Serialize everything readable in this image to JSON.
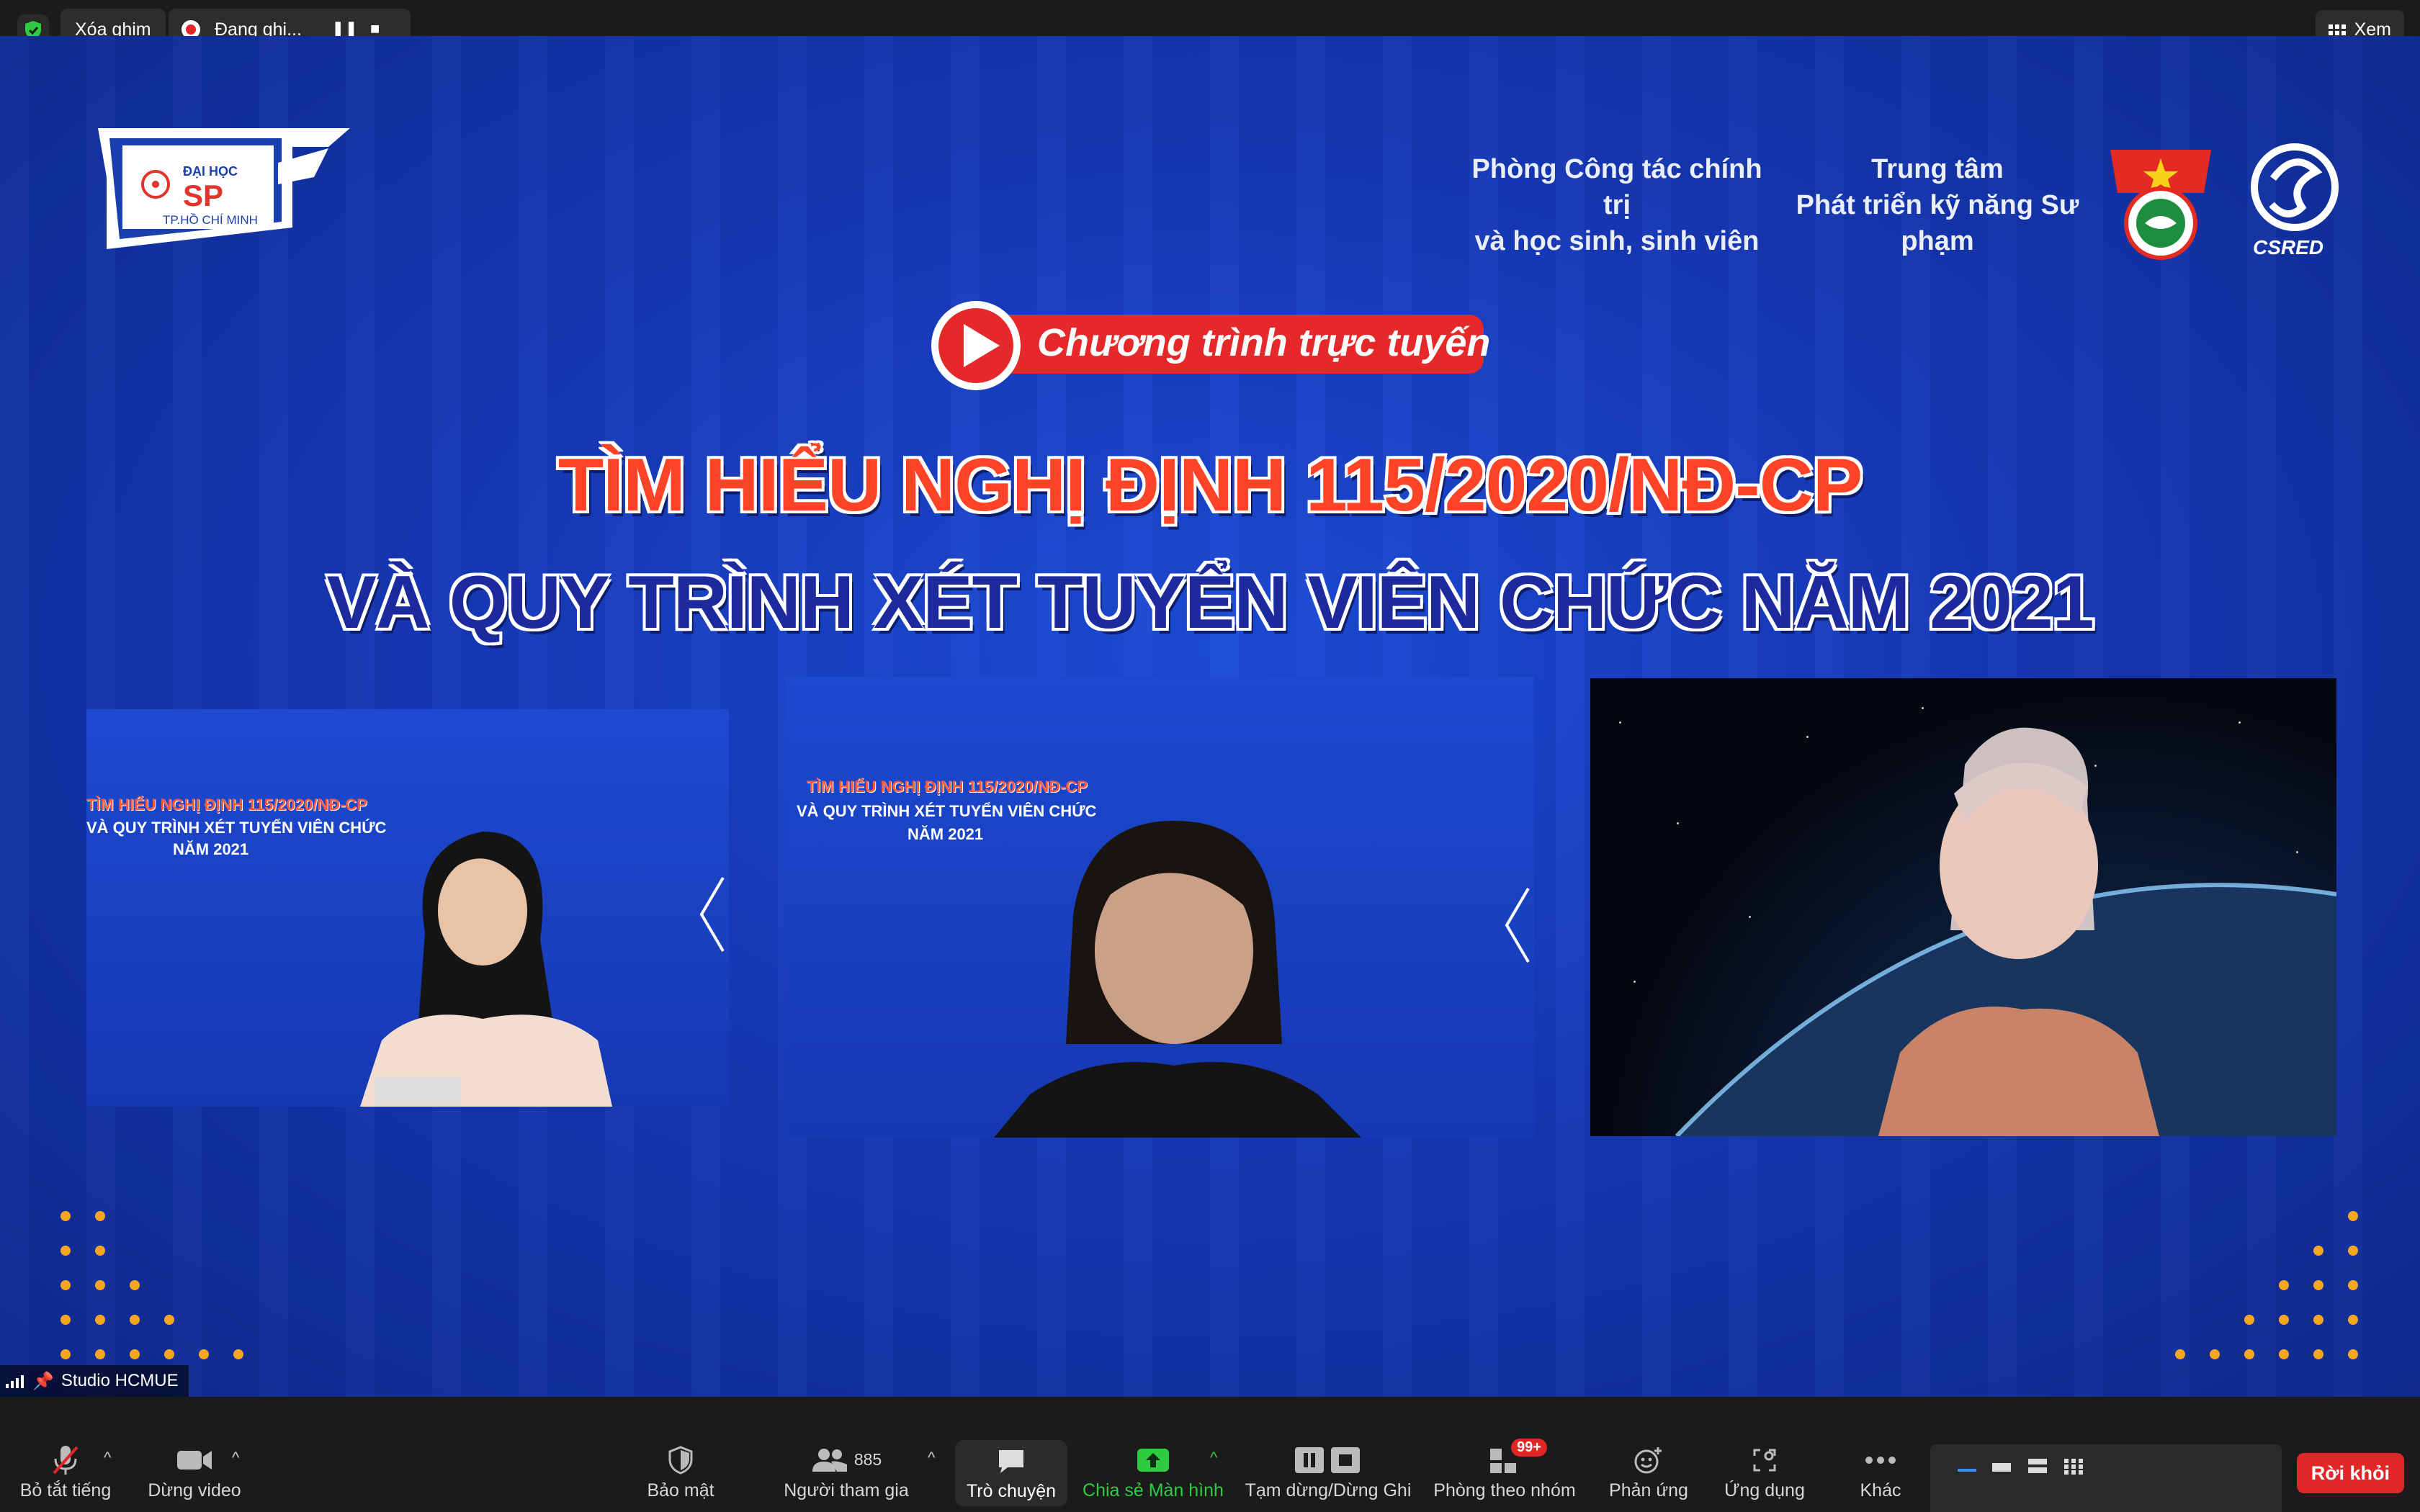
{
  "top_bar": {
    "unpin_label": "Xóa ghim",
    "recording_label": "Đang ghi...",
    "view_label": "Xem"
  },
  "stage": {
    "org_line1": "Phòng Công tác chính trị",
    "org_line2": "và học sinh, sinh viên",
    "center_line1": "Trung tâm",
    "center_line2": "Phát triển kỹ năng Sư phạm",
    "logo_top": "ĐẠI HỌC",
    "logo_mid": "SP",
    "logo_bottom": "TP.HỒ CHÍ MINH",
    "csred": "CSRED",
    "online_label": "Chương trình trực tuyến",
    "headline_1": "TÌM HIỂU NGHỊ ĐỊNH 115/2020/NĐ-CP",
    "headline_2": "VÀ QUY TRÌNH XÉT TUYỂN VIÊN CHỨC NĂM 2021",
    "mini_line1": "TÌM HIỂU NGHỊ ĐỊNH 115/2020/NĐ-CP",
    "mini_line2": "VÀ QUY TRÌNH XÉT TUYỂN VIÊN CHỨC",
    "mini_line3": "NĂM 2021"
  },
  "name_label": "Studio HCMUE",
  "toolbar": {
    "mute": "Bỏ tắt tiếng",
    "stop_video": "Dừng video",
    "security": "Bảo mật",
    "participants": "Người tham gia",
    "participants_count": "885",
    "chat": "Trò chuyện",
    "share": "Chia sẻ Màn hình",
    "pause_recording": "Tạm dừng/Dừng Ghi",
    "breakout": "Phòng theo nhóm",
    "breakout_badge": "99+",
    "reactions": "Phản ứng",
    "apps": "Ứng dụng",
    "more": "Khác",
    "leave": "Rời khỏi"
  },
  "colors": {
    "leave_red": "#e02828",
    "share_green": "#2ecc40",
    "headline_red": "#ff4327",
    "stage_blue": "#1638b7"
  }
}
